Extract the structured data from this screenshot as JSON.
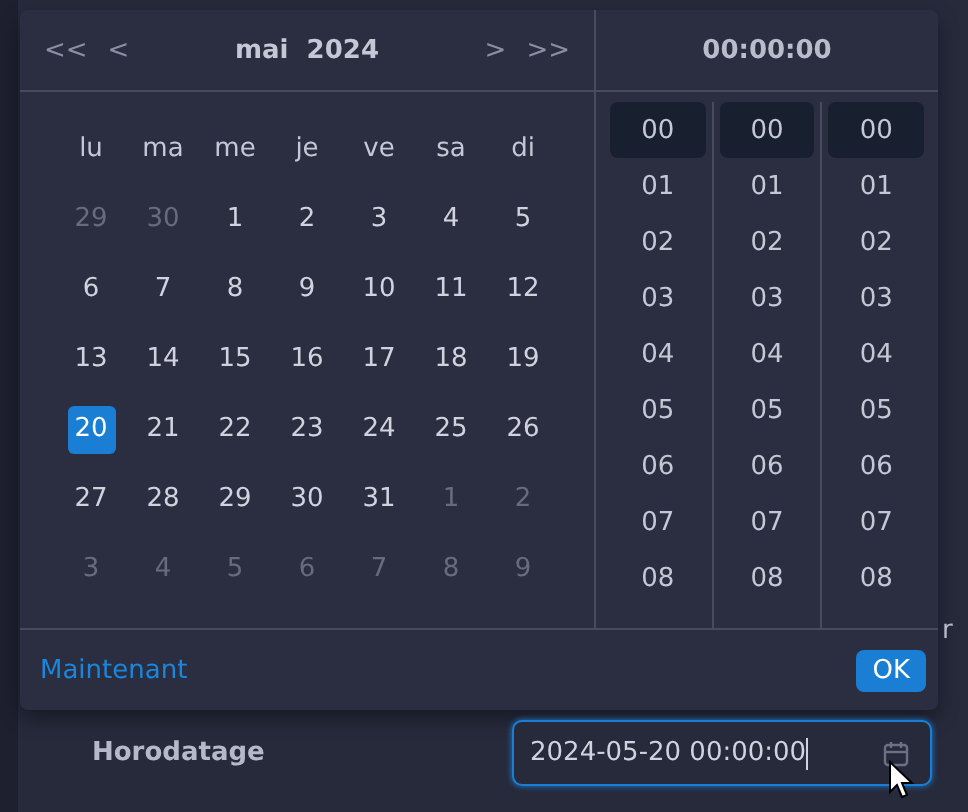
{
  "picker": {
    "month_year": "mai  2024",
    "time_header": "00:00:00",
    "nav": [
      "<<",
      "<",
      ">",
      ">>"
    ],
    "weekdays": [
      "lu",
      "ma",
      "me",
      "je",
      "ve",
      "sa",
      "di"
    ],
    "weeks": [
      [
        {
          "label": "29",
          "muted": true,
          "selected": false
        },
        {
          "label": "30",
          "muted": true,
          "selected": false
        },
        {
          "label": "1",
          "muted": false,
          "selected": false
        },
        {
          "label": "2",
          "muted": false,
          "selected": false
        },
        {
          "label": "3",
          "muted": false,
          "selected": false
        },
        {
          "label": "4",
          "muted": false,
          "selected": false
        },
        {
          "label": "5",
          "muted": false,
          "selected": false
        }
      ],
      [
        {
          "label": "6",
          "muted": false,
          "selected": false
        },
        {
          "label": "7",
          "muted": false,
          "selected": false
        },
        {
          "label": "8",
          "muted": false,
          "selected": false
        },
        {
          "label": "9",
          "muted": false,
          "selected": false
        },
        {
          "label": "10",
          "muted": false,
          "selected": false
        },
        {
          "label": "11",
          "muted": false,
          "selected": false
        },
        {
          "label": "12",
          "muted": false,
          "selected": false
        }
      ],
      [
        {
          "label": "13",
          "muted": false,
          "selected": false
        },
        {
          "label": "14",
          "muted": false,
          "selected": false
        },
        {
          "label": "15",
          "muted": false,
          "selected": false
        },
        {
          "label": "16",
          "muted": false,
          "selected": false
        },
        {
          "label": "17",
          "muted": false,
          "selected": false
        },
        {
          "label": "18",
          "muted": false,
          "selected": false
        },
        {
          "label": "19",
          "muted": false,
          "selected": false
        }
      ],
      [
        {
          "label": "20",
          "muted": false,
          "selected": true
        },
        {
          "label": "21",
          "muted": false,
          "selected": false
        },
        {
          "label": "22",
          "muted": false,
          "selected": false
        },
        {
          "label": "23",
          "muted": false,
          "selected": false
        },
        {
          "label": "24",
          "muted": false,
          "selected": false
        },
        {
          "label": "25",
          "muted": false,
          "selected": false
        },
        {
          "label": "26",
          "muted": false,
          "selected": false
        }
      ],
      [
        {
          "label": "27",
          "muted": false,
          "selected": false
        },
        {
          "label": "28",
          "muted": false,
          "selected": false
        },
        {
          "label": "29",
          "muted": false,
          "selected": false
        },
        {
          "label": "30",
          "muted": false,
          "selected": false
        },
        {
          "label": "31",
          "muted": false,
          "selected": false
        },
        {
          "label": "1",
          "muted": true,
          "selected": false
        },
        {
          "label": "2",
          "muted": true,
          "selected": false
        }
      ],
      [
        {
          "label": "3",
          "muted": true,
          "selected": false
        },
        {
          "label": "4",
          "muted": true,
          "selected": false
        },
        {
          "label": "5",
          "muted": true,
          "selected": false
        },
        {
          "label": "6",
          "muted": true,
          "selected": false
        },
        {
          "label": "7",
          "muted": true,
          "selected": false
        },
        {
          "label": "8",
          "muted": true,
          "selected": false
        },
        {
          "label": "9",
          "muted": true,
          "selected": false
        }
      ]
    ],
    "time_columns": [
      [
        {
          "label": "00",
          "selected": true
        },
        {
          "label": "01",
          "selected": false
        },
        {
          "label": "02",
          "selected": false
        },
        {
          "label": "03",
          "selected": false
        },
        {
          "label": "04",
          "selected": false
        },
        {
          "label": "05",
          "selected": false
        },
        {
          "label": "06",
          "selected": false
        },
        {
          "label": "07",
          "selected": false
        },
        {
          "label": "08",
          "selected": false
        }
      ],
      [
        {
          "label": "00",
          "selected": true
        },
        {
          "label": "01",
          "selected": false
        },
        {
          "label": "02",
          "selected": false
        },
        {
          "label": "03",
          "selected": false
        },
        {
          "label": "04",
          "selected": false
        },
        {
          "label": "05",
          "selected": false
        },
        {
          "label": "06",
          "selected": false
        },
        {
          "label": "07",
          "selected": false
        },
        {
          "label": "08",
          "selected": false
        }
      ],
      [
        {
          "label": "00",
          "selected": true
        },
        {
          "label": "01",
          "selected": false
        },
        {
          "label": "02",
          "selected": false
        },
        {
          "label": "03",
          "selected": false
        },
        {
          "label": "04",
          "selected": false
        },
        {
          "label": "05",
          "selected": false
        },
        {
          "label": "06",
          "selected": false
        },
        {
          "label": "07",
          "selected": false
        },
        {
          "label": "08",
          "selected": false
        }
      ]
    ],
    "now_link": "Maintenant",
    "ok_button": "OK"
  },
  "background_fragment": "r",
  "field": {
    "label": "Horodatage",
    "value": "2024-05-20 00:00:00"
  }
}
